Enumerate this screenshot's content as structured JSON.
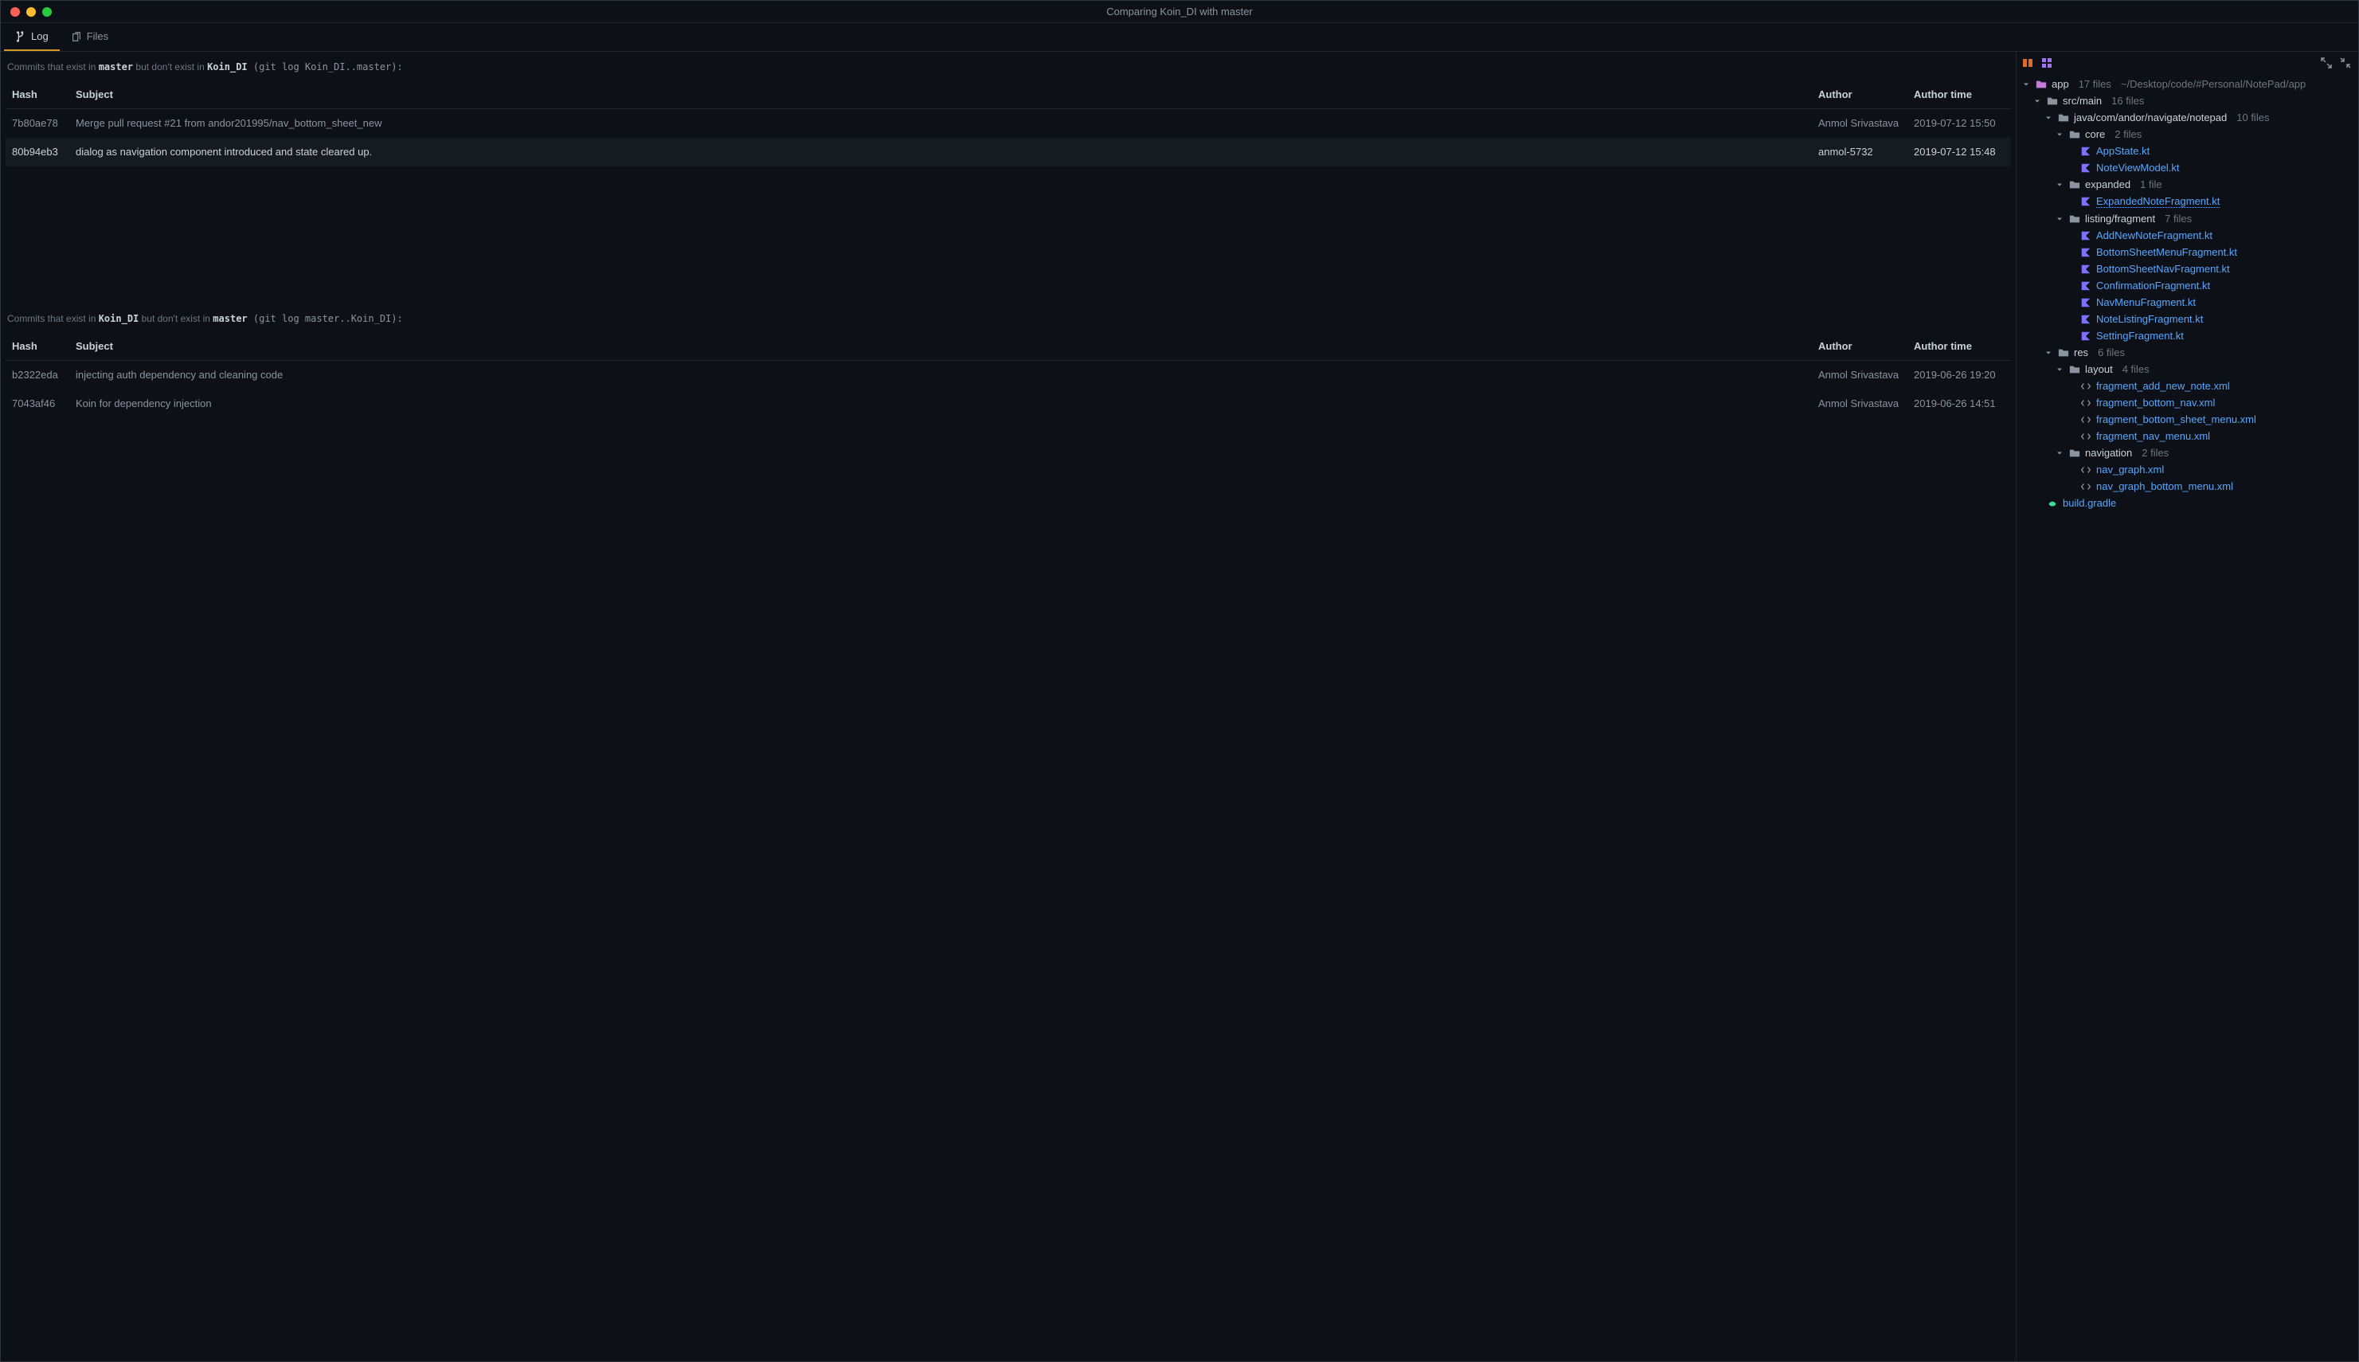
{
  "title": "Comparing Koin_DI with master",
  "tabs": {
    "log": "Log",
    "files": "Files"
  },
  "section1": {
    "prefix": "Commits that exist in ",
    "b1": "master",
    "mid": " but don't exist in ",
    "b2": "Koin_DI",
    "cmd": " (git log Koin_DI..master):"
  },
  "section2": {
    "prefix": "Commits that exist in ",
    "b1": "Koin_DI",
    "mid": " but don't exist in ",
    "b2": "master",
    "cmd": " (git log master..Koin_DI):"
  },
  "headers": {
    "hash": "Hash",
    "subject": "Subject",
    "author": "Author",
    "time": "Author time"
  },
  "commits1": [
    {
      "hash": "7b80ae78",
      "subject": "Merge pull request #21 from andor201995/nav_bottom_sheet_new",
      "author": "Anmol Srivastava",
      "time": "2019-07-12 15:50"
    },
    {
      "hash": "80b94eb3",
      "subject": "dialog as navigation component introduced and state cleared up.",
      "author": "anmol-5732",
      "time": "2019-07-12 15:48"
    }
  ],
  "commits2": [
    {
      "hash": "b2322eda",
      "subject": "injecting auth dependency and cleaning code",
      "author": "Anmol Srivastava",
      "time": "2019-06-26 19:20"
    },
    {
      "hash": "7043af46",
      "subject": "Koin for dependency injection",
      "author": "Anmol Srivastava",
      "time": "2019-06-26 14:51"
    }
  ],
  "tree": {
    "app": {
      "name": "app",
      "count": "17 files",
      "path": "~/Desktop/code/#Personal/NotePad/app"
    },
    "src": {
      "name": "src/main",
      "count": "16 files"
    },
    "java": {
      "name": "java/com/andor/navigate/notepad",
      "count": "10 files"
    },
    "core": {
      "name": "core",
      "count": "2 files"
    },
    "core_files": [
      "AppState.kt",
      "NoteViewModel.kt"
    ],
    "expanded": {
      "name": "expanded",
      "count": "1 file"
    },
    "expanded_files": [
      "ExpandedNoteFragment.kt"
    ],
    "listing": {
      "name": "listing/fragment",
      "count": "7 files"
    },
    "listing_files": [
      "AddNewNoteFragment.kt",
      "BottomSheetMenuFragment.kt",
      "BottomSheetNavFragment.kt",
      "ConfirmationFragment.kt",
      "NavMenuFragment.kt",
      "NoteListingFragment.kt",
      "SettingFragment.kt"
    ],
    "res": {
      "name": "res",
      "count": "6 files"
    },
    "layout": {
      "name": "layout",
      "count": "4 files"
    },
    "layout_files": [
      "fragment_add_new_note.xml",
      "fragment_bottom_nav.xml",
      "fragment_bottom_sheet_menu.xml",
      "fragment_nav_menu.xml"
    ],
    "navigation": {
      "name": "navigation",
      "count": "2 files"
    },
    "navigation_files": [
      "nav_graph.xml",
      "nav_graph_bottom_menu.xml"
    ],
    "gradle": "build.gradle"
  }
}
